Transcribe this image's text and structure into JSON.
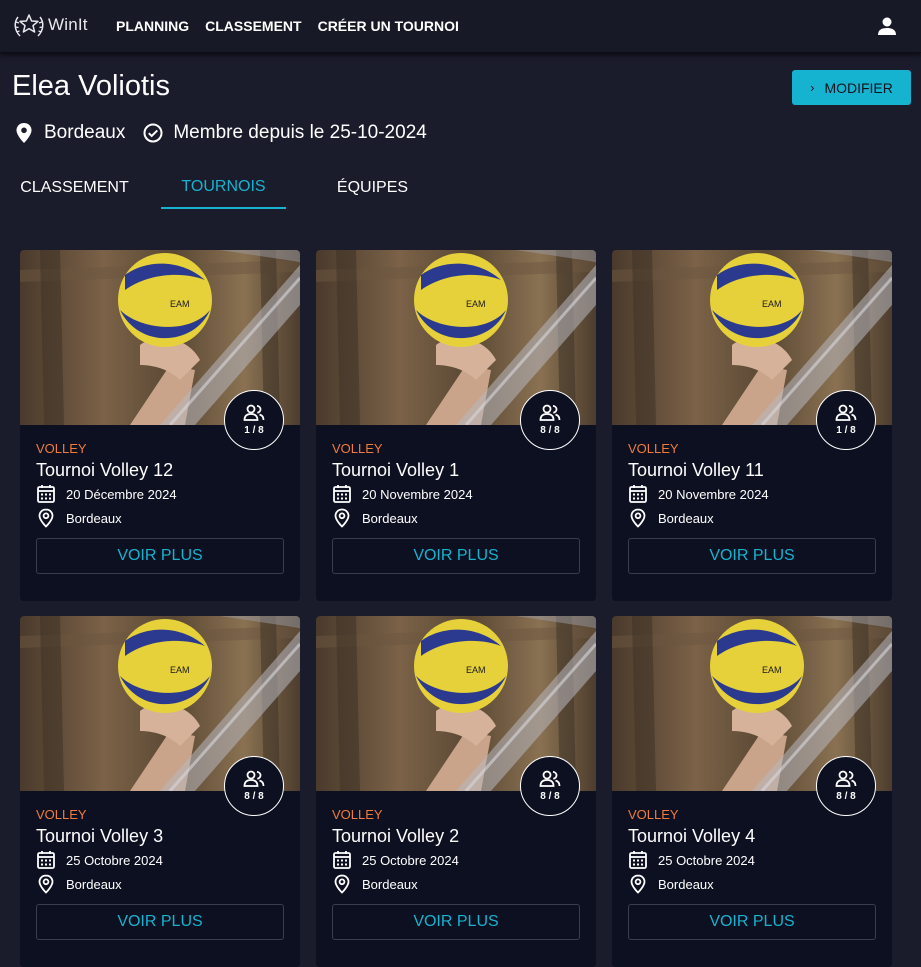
{
  "app": {
    "logo_text": "WinIt"
  },
  "nav": {
    "planning": "PLANNING",
    "classement": "CLASSEMENT",
    "creer": "CRÉER UN TOURNOI"
  },
  "profile": {
    "name": "Elea Voliotis",
    "edit_label": "MODIFIER",
    "city": "Bordeaux",
    "member_since": "Membre depuis le 25-10-2024"
  },
  "tabs": [
    {
      "label": "CLASSEMENT",
      "active": false
    },
    {
      "label": "TOURNOIS",
      "active": true
    },
    {
      "label": "ÉQUIPES",
      "active": false
    }
  ],
  "cards": [
    {
      "sport": "VOLLEY",
      "title": "Tournoi Volley 12",
      "date": "20 Décembre 2024",
      "location": "Bordeaux",
      "participants": "1 / 8",
      "button": "VOIR PLUS"
    },
    {
      "sport": "VOLLEY",
      "title": "Tournoi Volley 1",
      "date": "20 Novembre 2024",
      "location": "Bordeaux",
      "participants": "8 / 8",
      "button": "VOIR PLUS"
    },
    {
      "sport": "VOLLEY",
      "title": "Tournoi Volley 11",
      "date": "20 Novembre 2024",
      "location": "Bordeaux",
      "participants": "1 / 8",
      "button": "VOIR PLUS"
    },
    {
      "sport": "VOLLEY",
      "title": "Tournoi Volley 3",
      "date": "25 Octobre 2024",
      "location": "Bordeaux",
      "participants": "8 / 8",
      "button": "VOIR PLUS"
    },
    {
      "sport": "VOLLEY",
      "title": "Tournoi Volley 2",
      "date": "25 Octobre 2024",
      "location": "Bordeaux",
      "participants": "8 / 8",
      "button": "VOIR PLUS"
    },
    {
      "sport": "VOLLEY",
      "title": "Tournoi Volley 4",
      "date": "25 Octobre 2024",
      "location": "Bordeaux",
      "participants": "8 / 8",
      "button": "VOIR PLUS"
    }
  ],
  "icons": {
    "logo": "laurel-star-icon",
    "user": "user-icon",
    "location": "location-pin-icon",
    "member": "check-circle-icon",
    "participants": "group-icon",
    "calendar": "calendar-icon"
  },
  "colors": {
    "accent": "#16b3d1",
    "sport": "#f07b3b",
    "background": "#1a1b2b",
    "card": "#0d1020"
  }
}
